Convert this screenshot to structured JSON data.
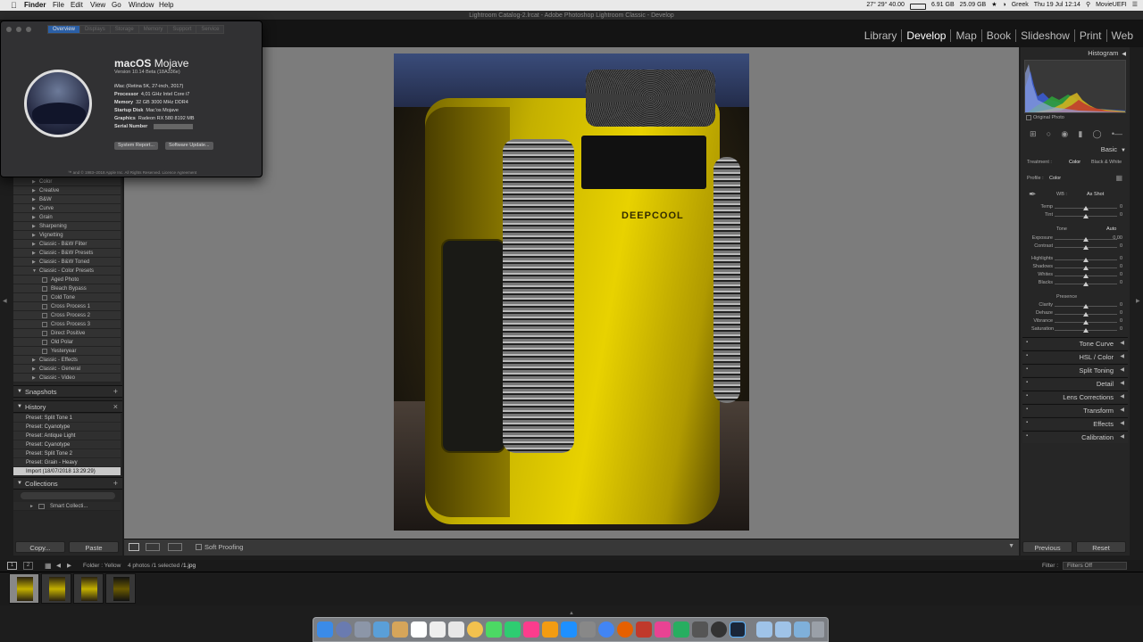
{
  "menubar": {
    "app": "Finder",
    "items": [
      "File",
      "Edit",
      "View",
      "Go",
      "Window",
      "Help"
    ],
    "status": [
      "27° 29° 40.00",
      "6.91 GB",
      "25.09 GB",
      "Greek",
      "Thu 19 Jul  12:14",
      "MovieUEFI"
    ]
  },
  "window_title": "Lightroom Catalog-2.lrcat - Adobe Photoshop Lightroom Classic - Develop",
  "modules": [
    "Library",
    "Develop",
    "Map",
    "Book",
    "Slideshow",
    "Print",
    "Web"
  ],
  "active_module": "Develop",
  "about": {
    "tabs": [
      "Overview",
      "Displays",
      "Storage",
      "Memory",
      "Support",
      "Service"
    ],
    "os_name_bold": "macOS",
    "os_name_light": "Mojave",
    "version": "Version 10.14 Beta (18A336e)",
    "specs": [
      {
        "label": "iMac (Retina 5K, 27-inch, 2017)",
        "value": ""
      },
      {
        "label": "Processor",
        "value": "4,01 GHz Intel Core i7"
      },
      {
        "label": "Memory",
        "value": "32 GB 3000 MHz DDR4"
      },
      {
        "label": "Startup Disk",
        "value": "Mac'os Mojave"
      },
      {
        "label": "Graphics",
        "value": "Radeon RX 580 8192 MB"
      },
      {
        "label": "Serial Number",
        "value": ""
      }
    ],
    "btn_report": "System Report...",
    "btn_update": "Software Update...",
    "copyright": "™ and © 1983–2018 Apple Inc. All Rights Reserved. Licence Agreement"
  },
  "presets": [
    {
      "label": "Color",
      "type": "folder"
    },
    {
      "label": "Creative",
      "type": "folder"
    },
    {
      "label": "B&W",
      "type": "folder"
    },
    {
      "label": "Curve",
      "type": "folder"
    },
    {
      "label": "Grain",
      "type": "folder"
    },
    {
      "label": "Sharpening",
      "type": "folder"
    },
    {
      "label": "Vignetting",
      "type": "folder"
    },
    {
      "label": "Classic - B&W Filter",
      "type": "folder"
    },
    {
      "label": "Classic - B&W Presets",
      "type": "folder"
    },
    {
      "label": "Classic - B&W Toned",
      "type": "folder"
    },
    {
      "label": "Classic - Color Presets",
      "type": "open"
    },
    {
      "label": "Aged Photo",
      "type": "item"
    },
    {
      "label": "Bleach Bypass",
      "type": "item"
    },
    {
      "label": "Cold Tone",
      "type": "item"
    },
    {
      "label": "Cross Process 1",
      "type": "item"
    },
    {
      "label": "Cross Process 2",
      "type": "item"
    },
    {
      "label": "Cross Process 3",
      "type": "item"
    },
    {
      "label": "Direct Positive",
      "type": "item"
    },
    {
      "label": "Old Polar",
      "type": "item"
    },
    {
      "label": "Yesteryear",
      "type": "item"
    },
    {
      "label": "Classic - Effects",
      "type": "folder"
    },
    {
      "label": "Classic - General",
      "type": "folder"
    },
    {
      "label": "Classic - Video",
      "type": "folder"
    }
  ],
  "snapshots_title": "Snapshots",
  "history_title": "History",
  "history": [
    "Preset: Split Tone 1",
    "Preset: Cyanotype",
    "Preset: Antique Light",
    "Preset: Cyanotype",
    "Preset: Split Tone 2",
    "Preset: Grain - Heavy",
    "Import (18/07/2018 13:29:29)"
  ],
  "collections_title": "Collections",
  "collections": [
    "Smart Collecti..."
  ],
  "left_buttons": {
    "copy": "Copy...",
    "paste": "Paste"
  },
  "toolbar": {
    "soft_proofing": "Soft Proofing"
  },
  "right": {
    "histogram_title": "Histogram",
    "original_photo": "Original Photo",
    "basic_title": "Basic",
    "treatment_label": "Treatment :",
    "treatment_color": "Color",
    "treatment_bw": "Black & White",
    "profile_label": "Profile :",
    "profile_value": "Color",
    "wb_label": "WB :",
    "wb_value": "As Shot",
    "tone_label": "Tone",
    "tone_auto": "Auto",
    "presence_label": "Presence",
    "sliders_wb": [
      {
        "label": "Temp",
        "value": "0"
      },
      {
        "label": "Tint",
        "value": "0"
      }
    ],
    "sliders_tone1": [
      {
        "label": "Exposure",
        "value": "0,00"
      },
      {
        "label": "Contrast",
        "value": "0"
      }
    ],
    "sliders_tone2": [
      {
        "label": "Highlights",
        "value": "0"
      },
      {
        "label": "Shadows",
        "value": "0"
      },
      {
        "label": "Whites",
        "value": "0"
      },
      {
        "label": "Blacks",
        "value": "0"
      }
    ],
    "sliders_presence": [
      {
        "label": "Clarity",
        "value": "0"
      },
      {
        "label": "Dehaze",
        "value": "0"
      },
      {
        "label": "Vibrance",
        "value": "0"
      },
      {
        "label": "Saturation",
        "value": "0"
      }
    ],
    "sections": [
      "Tone Curve",
      "HSL / Color",
      "Split Toning",
      "Detail",
      "Lens Corrections",
      "Transform",
      "Effects",
      "Calibration"
    ],
    "previous": "Previous",
    "reset": "Reset"
  },
  "filmstrip": {
    "page1": "1",
    "page2": "2",
    "folder": "Folder : Yellow",
    "count": "4 photos /1 selected /",
    "file": "1.jpg",
    "filter_label": "Filter :",
    "filter_value": "Filters Off"
  },
  "photo": {
    "logo": "DEEPCOOL"
  }
}
